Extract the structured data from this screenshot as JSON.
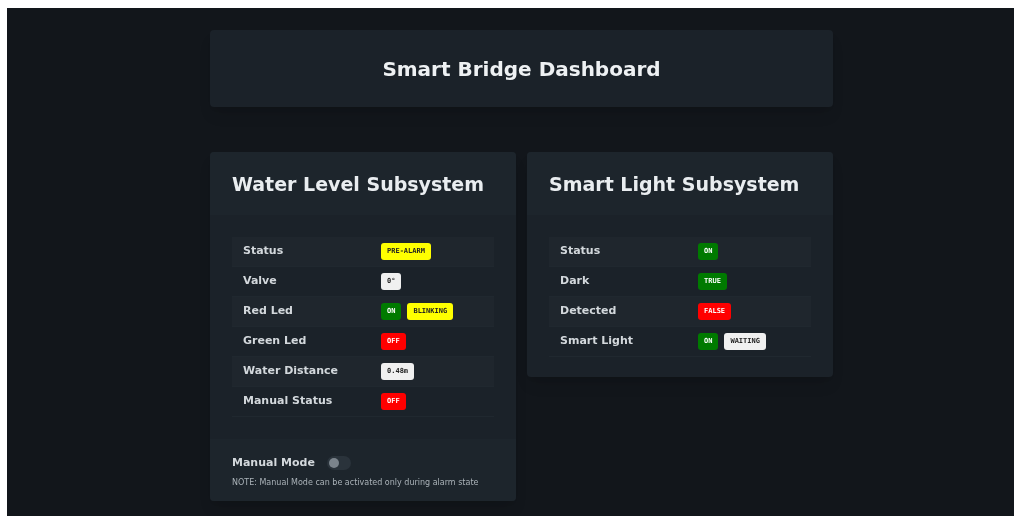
{
  "header": {
    "title": "Smart Bridge Dashboard"
  },
  "panels": [
    {
      "title": "Water Level Subsystem",
      "rows": [
        {
          "label": "Status",
          "badges": [
            {
              "text": "PRE-ALARM",
              "color": "#ffff00"
            }
          ]
        },
        {
          "label": "Valve",
          "badges": [
            {
              "text": "0°",
              "color": "#f0f0f0"
            }
          ]
        },
        {
          "label": "Red Led",
          "badges": [
            {
              "text": "ON",
              "color": "#007a00"
            },
            {
              "text": "BLINKING",
              "color": "#ffff00"
            }
          ]
        },
        {
          "label": "Green Led",
          "badges": [
            {
              "text": "OFF",
              "color": "#ff0000"
            }
          ]
        },
        {
          "label": "Water Distance",
          "badges": [
            {
              "text": "0.48m",
              "color": "#f0f0f0"
            }
          ]
        },
        {
          "label": "Manual Status",
          "badges": [
            {
              "text": "OFF",
              "color": "#ff0000"
            }
          ]
        }
      ],
      "footer": {
        "toggle_label": "Manual Mode",
        "on": false,
        "note": "NOTE: Manual Mode can be activated only during alarm state"
      }
    },
    {
      "title": "Smart Light Subsystem",
      "rows": [
        {
          "label": "Status",
          "badges": [
            {
              "text": "ON",
              "color": "#007a00"
            }
          ]
        },
        {
          "label": "Dark",
          "badges": [
            {
              "text": "TRUE",
              "color": "#007a00"
            }
          ]
        },
        {
          "label": "Detected",
          "badges": [
            {
              "text": "FALSE",
              "color": "#ff0000"
            }
          ]
        },
        {
          "label": "Smart Light",
          "badges": [
            {
              "text": "ON",
              "color": "#007a00"
            },
            {
              "text": "WAITING",
              "color": "#f0f0f0"
            }
          ]
        }
      ]
    }
  ]
}
